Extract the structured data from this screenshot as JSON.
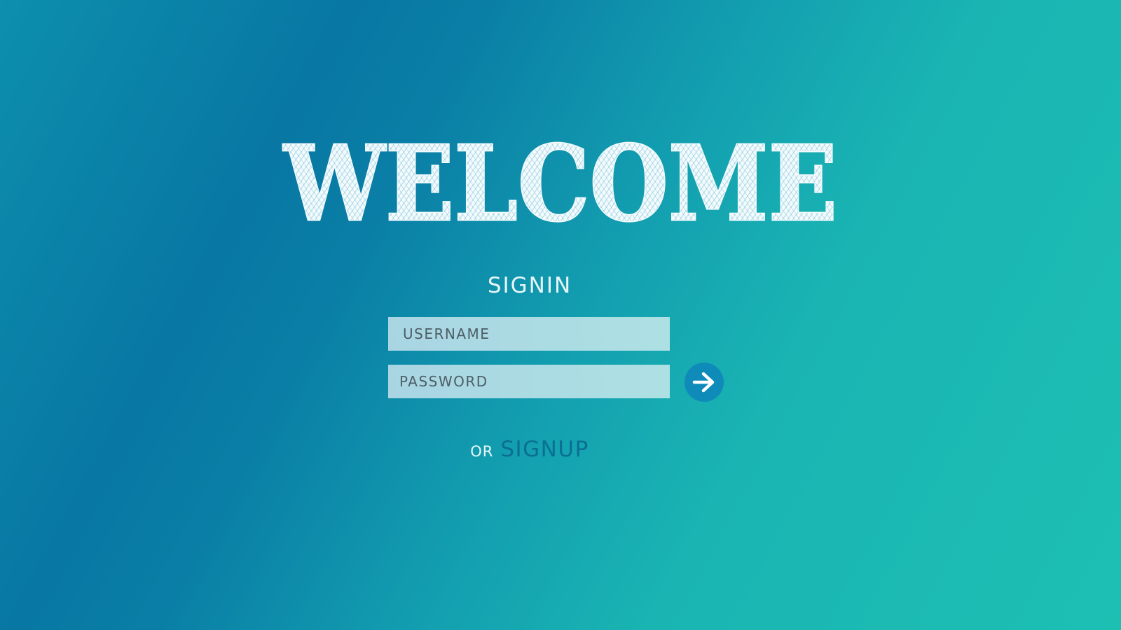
{
  "hero": {
    "title": "WELCOME"
  },
  "signin": {
    "title": "SIGNIN",
    "username_placeholder": "USERNAME",
    "password_placeholder": "PASSWORD",
    "submit_icon": "arrow-right-icon"
  },
  "signup": {
    "or_text": "OR",
    "link_label": "SIGNUP"
  },
  "colors": {
    "gradient_dark": "#0877a3",
    "gradient_light": "#1dbfb3",
    "field_bg": "#ade0e3",
    "button_bg": "#0f8bba",
    "signup_link": "#0b6e93"
  }
}
